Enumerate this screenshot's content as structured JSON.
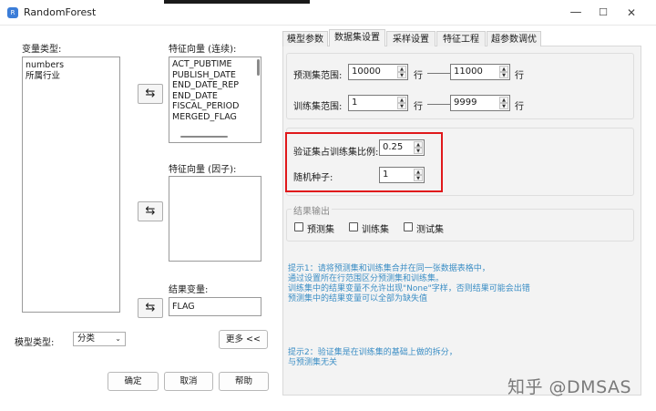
{
  "window": {
    "title": "RandomForest",
    "minimize": "—",
    "maximize": "☐",
    "close": "✕"
  },
  "left": {
    "var_type_label": "变量类型:",
    "var_types": [
      "numbers",
      "所属行业"
    ],
    "feature_cont_label": "特征向量 (连续):",
    "feature_cont": [
      "ACT_PUBTIME",
      "PUBLISH_DATE",
      "END_DATE_REP",
      "END_DATE",
      "FISCAL_PERIOD",
      "MERGED_FLAG"
    ],
    "feature_factor_label": "特征向量 (因子):",
    "result_label": "结果变量:",
    "result_value": "FLAG",
    "model_type_label": "模型类型:",
    "model_type_value": "分类",
    "more_button": "更多 <<",
    "ok_button": "确定",
    "cancel_button": "取消",
    "help_button": "帮助",
    "swap_glyph": "⇆"
  },
  "tabs": [
    "模型参数",
    "数据集设置",
    "采样设置",
    "特征工程",
    "超参数调优"
  ],
  "active_tab": "数据集设置",
  "dataset": {
    "predict_label": "预测集范围:",
    "predict_from": "10000",
    "predict_to": "11000",
    "train_label": "训练集范围:",
    "train_from": "1",
    "train_to": "9999",
    "row_unit": "行",
    "valid_ratio_label": "验证集占训练集比例:",
    "valid_ratio": "0.25",
    "seed_label": "随机种子:",
    "seed": "1",
    "output_group_label": "结果输出",
    "output_options": [
      "预测集",
      "训练集",
      "测试集"
    ]
  },
  "hints": {
    "hint1": [
      "提示1：请将预测集和训练集合并在同一张数据表格中，",
      "通过设置所在行范围区分预测集和训练集。",
      "训练集中的结果变量不允许出现\"None\"字样，否则结果可能会出错",
      "预测集中的结果变量可以全部为缺失值"
    ],
    "hint2": [
      "提示2：验证集是在训练集的基础上做的拆分，",
      "与预测集无关"
    ]
  },
  "watermark": "知乎 @DMSAS",
  "colors": {
    "accent_hint": "#3b8ec5",
    "highlight_box": "#e0181b",
    "app_icon": "#3b7dd8"
  }
}
